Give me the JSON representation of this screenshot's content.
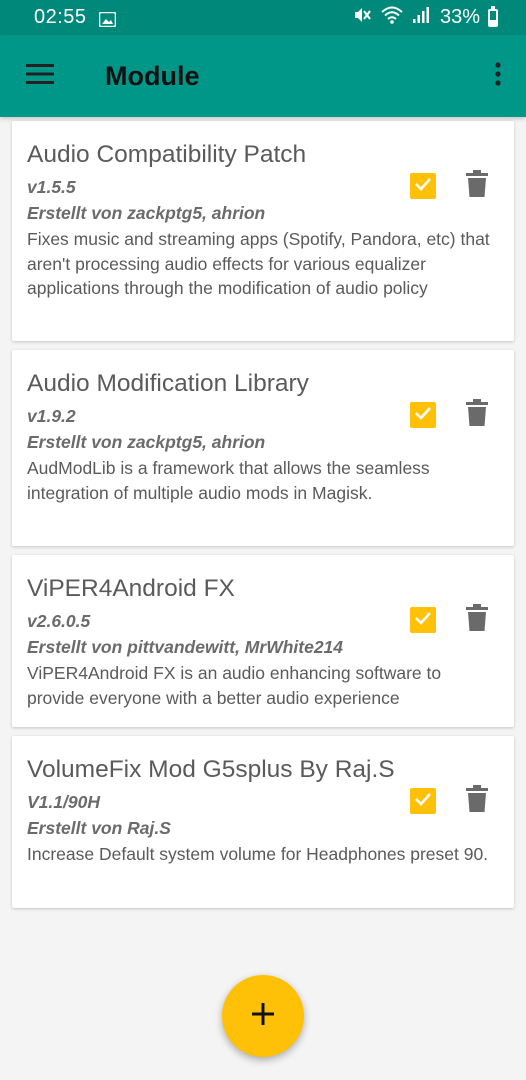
{
  "status_bar": {
    "time": "02:55",
    "battery_percent": "33%",
    "icons": [
      "image-icon",
      "mute-icon",
      "wifi-icon",
      "signal-icon",
      "battery-icon"
    ]
  },
  "app_bar": {
    "title": "Module",
    "menu_icon": "hamburger-icon",
    "overflow_icon": "more-vert-icon"
  },
  "colors": {
    "status_bar": "#00897b",
    "app_bar": "#009688",
    "accent": "#ffc107",
    "background": "#f4f4f4"
  },
  "modules": [
    {
      "name": "Audio Compatibility Patch",
      "version": "v1.5.5",
      "author": "Erstellt von zackptg5, ahrion",
      "description": "Fixes music and streaming apps (Spotify, Pandora, etc) that aren't processing audio effects for various equalizer applications through the modification of audio policy",
      "enabled": true
    },
    {
      "name": "Audio Modification Library",
      "version": "v1.9.2",
      "author": "Erstellt von zackptg5, ahrion",
      "description": "AudModLib is a framework that allows the seamless integration of multiple audio mods in Magisk.",
      "enabled": true
    },
    {
      "name": "ViPER4Android FX",
      "version": "v2.6.0.5",
      "author": "Erstellt von pittvandewitt, MrWhite214",
      "description": "ViPER4Android FX is an audio enhancing software to provide everyone with a better audio experience",
      "enabled": true
    },
    {
      "name": "VolumeFix Mod G5splus By Raj.S",
      "version": "V1.1/90H",
      "author": "Erstellt von Raj.S",
      "description": "Increase Default system volume for Headphones preset 90.",
      "enabled": true
    }
  ],
  "fab": {
    "icon": "plus-icon"
  }
}
